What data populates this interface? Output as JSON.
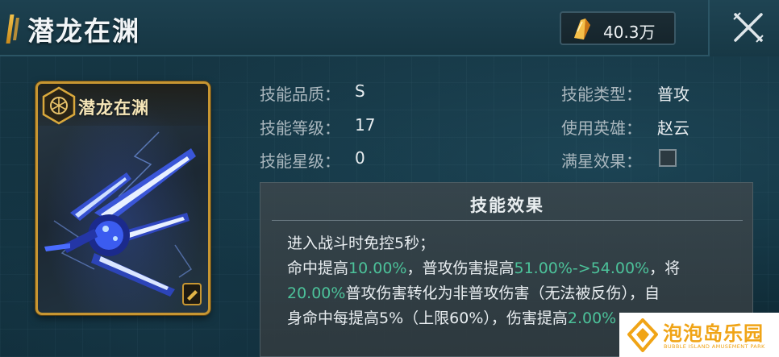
{
  "header": {
    "title": "潜龙在渊",
    "currency_value": "40.3万",
    "currency_icon": "crystal-icon",
    "close_icon": "close-icon"
  },
  "card": {
    "title": "潜龙在渊",
    "emblem_icon": "hex-emblem-icon",
    "art": "blue-mecha-blade-illustration",
    "corner_icon": "tag-icon"
  },
  "stats": {
    "quality_label": "技能品质：",
    "quality_value": "S",
    "level_label": "技能等级：",
    "level_value": "17",
    "star_label": "技能星级：",
    "star_value": "0",
    "type_label": "技能类型：",
    "type_value": "普攻",
    "hero_label": "使用英雄：",
    "hero_value": "赵云",
    "fullstar_label": "满星效果：",
    "fullstar_checked": false
  },
  "effect": {
    "title": "技能效果",
    "line1": "进入战斗时免控5秒；",
    "line2_a": "命中提高",
    "line2_b": "10.00%",
    "line2_c": "，普攻伤害提高",
    "line2_d": "51.00%->54.00%",
    "line2_e": "，将",
    "line3_a": "20.00%",
    "line3_b": "普攻伤害转化为非普攻伤害（无法被反伤），自",
    "line4_a": "身命中每提高5%（上限60%），伤害提高",
    "line4_b": "2.00%",
    "highlight_color": "#4cc29a"
  },
  "watermark": {
    "name": "泡泡岛乐园",
    "sub": "BUBBLE ISLAND AMUSEMENT PARK"
  }
}
